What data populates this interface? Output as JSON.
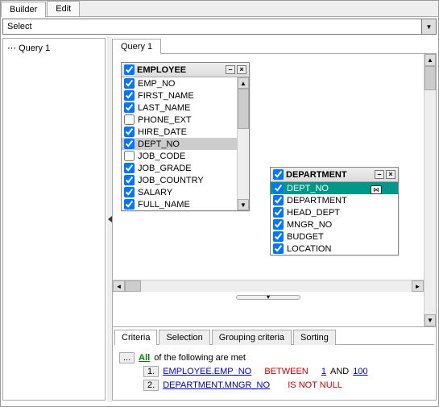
{
  "outer_tabs": {
    "builder": "Builder",
    "edit": "Edit",
    "active": "builder"
  },
  "select_row": {
    "label": "Select"
  },
  "tree": {
    "node": "Query 1"
  },
  "inner_tab": {
    "label": "Query 1"
  },
  "tables": {
    "employee": {
      "title": "EMPLOYEE",
      "rows": [
        {
          "label": "EMP_NO",
          "checked": true
        },
        {
          "label": "FIRST_NAME",
          "checked": true
        },
        {
          "label": "LAST_NAME",
          "checked": true
        },
        {
          "label": "PHONE_EXT",
          "checked": false
        },
        {
          "label": "HIRE_DATE",
          "checked": true
        },
        {
          "label": "DEPT_NO",
          "checked": true,
          "selected": true
        },
        {
          "label": "JOB_CODE",
          "checked": false
        },
        {
          "label": "JOB_GRADE",
          "checked": true
        },
        {
          "label": "JOB_COUNTRY",
          "checked": true
        },
        {
          "label": "SALARY",
          "checked": true
        },
        {
          "label": "FULL_NAME",
          "checked": true
        }
      ]
    },
    "department": {
      "title": "DEPARTMENT",
      "rows": [
        {
          "label": "DEPT_NO",
          "checked": true,
          "highlight": true
        },
        {
          "label": "DEPARTMENT",
          "checked": true
        },
        {
          "label": "HEAD_DEPT",
          "checked": true
        },
        {
          "label": "MNGR_NO",
          "checked": true
        },
        {
          "label": "BUDGET",
          "checked": true
        },
        {
          "label": "LOCATION",
          "checked": true
        }
      ]
    }
  },
  "criteria": {
    "tabs": {
      "criteria": "Criteria",
      "selection": "Selection",
      "grouping": "Grouping criteria",
      "sorting": "Sorting"
    },
    "root_btn": "...",
    "root_all": "All",
    "root_text": "of the following are met",
    "row1": {
      "num": "1.",
      "field": "EMPLOYEE.EMP_NO",
      "op": "BETWEEN",
      "v1": "1",
      "and": "AND",
      "v2": "100"
    },
    "row2": {
      "num": "2.",
      "field": "DEPARTMENT.MNGR_NO",
      "op": "IS NOT NULL"
    }
  }
}
